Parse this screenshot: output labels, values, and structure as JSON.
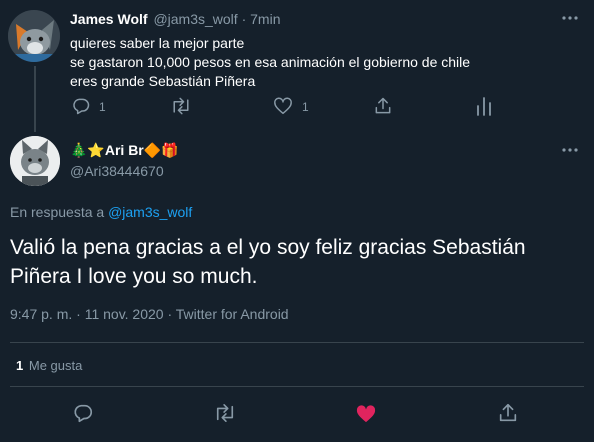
{
  "parent_tweet": {
    "author_name": "James Wolf",
    "author_handle": "@jam3s_wolf",
    "separator": "·",
    "time": "7min",
    "lines": [
      "quieres saber la mejor parte",
      "se gastaron 10,000 pesos en esa animación el gobierno de chile",
      "eres grande Sebastián Piñera"
    ],
    "reply_count": "1",
    "like_count": "1"
  },
  "main_tweet": {
    "author_name": "🎄⭐Ari Br🔶🎁",
    "author_handle": "@Ari38444670",
    "replying_prefix": "En respuesta a",
    "replying_to": "@jam3s_wolf",
    "text_line1": "Valió la pena gracias a el yo soy feliz gracias Sebastián",
    "text_line2": "Piñera I love you so much.",
    "meta": "9:47 p. m. · 11 nov. 2020 · Twitter for Android",
    "likes_count": "1",
    "likes_label": "Me gusta"
  },
  "colors": {
    "background": "#15202b",
    "text": "#ffffff",
    "muted": "#8899a6",
    "accent": "#1da1f2",
    "liked": "#e0245e",
    "divider": "#38444d"
  },
  "icons": [
    "reply-icon",
    "retweet-icon",
    "like-icon",
    "share-icon",
    "analytics-icon",
    "more-icon"
  ]
}
